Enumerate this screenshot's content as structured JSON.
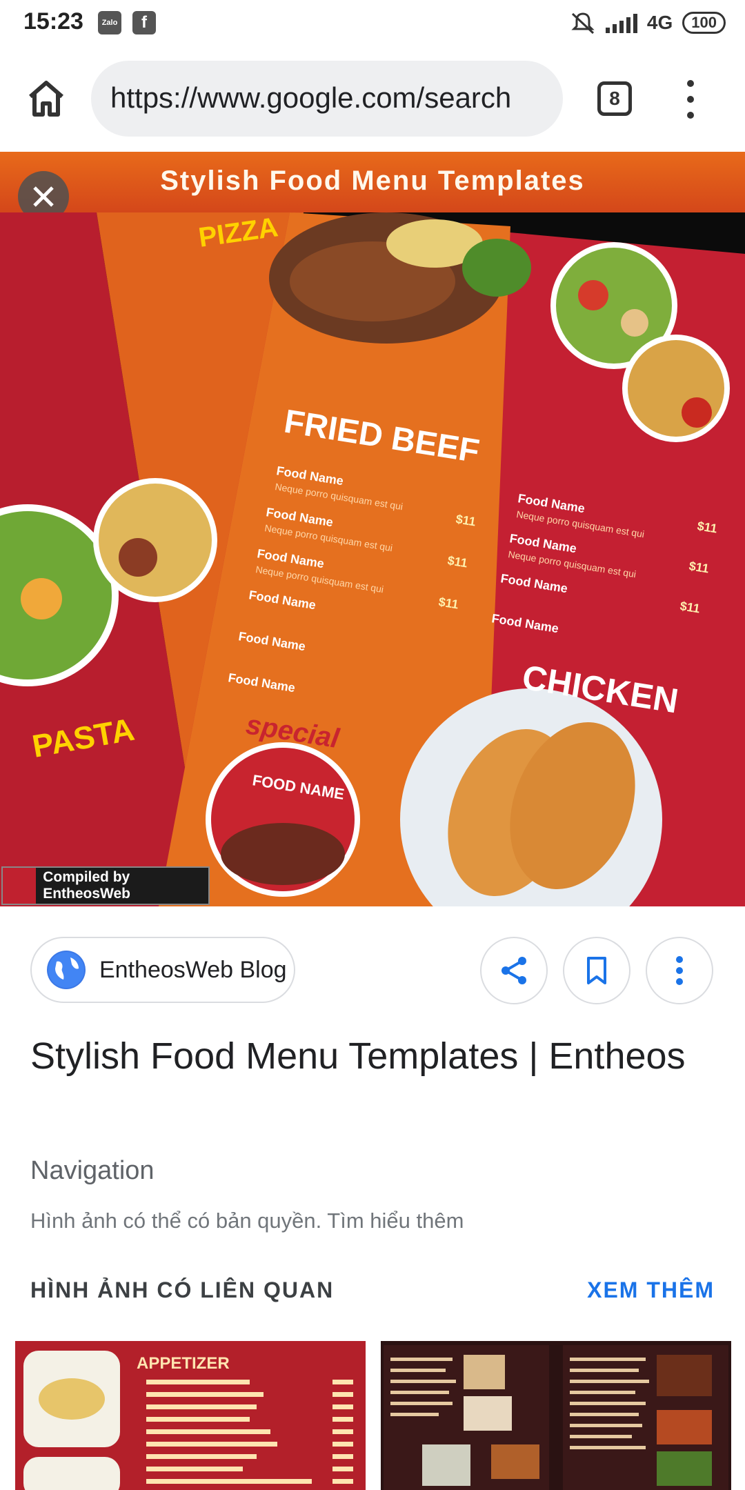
{
  "status": {
    "time": "15:23",
    "app1": "Zalo",
    "app2": "f",
    "network": "4G",
    "battery": "100"
  },
  "browser": {
    "url": "https://www.google.com/search",
    "tab_count": "8"
  },
  "image": {
    "banner_title": "Stylish Food Menu Templates",
    "credit": "Compiled by EntheosWeb",
    "menu": {
      "headings": [
        "PIZZA",
        "FRIED BEEF",
        "PASTA",
        "CHICKEN",
        "special",
        "FOOD NAME"
      ],
      "item_name": "Food Name",
      "item_desc": "Neque porro quisquam est qui",
      "price": "$11"
    }
  },
  "result": {
    "source": "EntheosWeb Blog",
    "title": "Stylish Food Menu Templates | Entheos",
    "subtitle": "Navigation",
    "copyright": "Hình ảnh có thể có bản quyền. Tìm hiểu thêm"
  },
  "related": {
    "heading": "HÌNH ẢNH CÓ LIÊN QUAN",
    "see_more": "XEM THÊM",
    "thumb1_heading": "APPETIZER"
  },
  "colors": {
    "accent": "#1a73e8",
    "menu_red": "#c0212f",
    "menu_orange": "#e8701e"
  }
}
